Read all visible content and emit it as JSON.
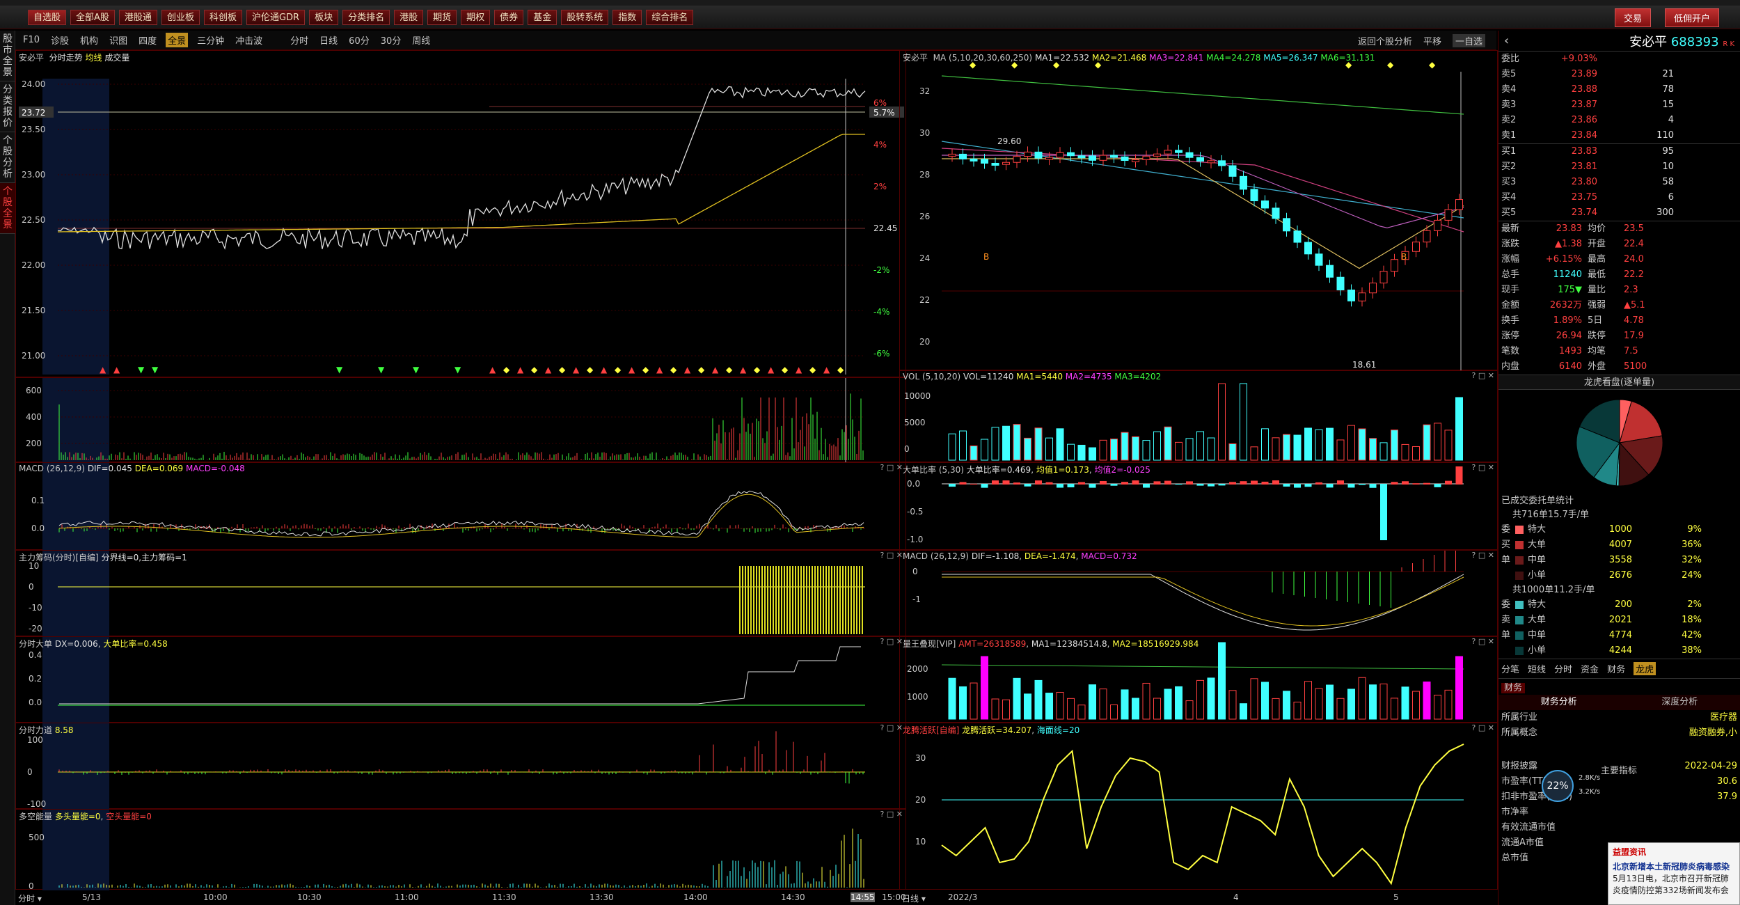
{
  "toolbar": {
    "buttons": [
      "自选股",
      "全部A股",
      "港股通",
      "创业板",
      "科创板",
      "沪伦通GDR",
      "板块",
      "分类排名",
      "港股",
      "期货",
      "期权",
      "债券",
      "基金",
      "股转系统",
      "指数",
      "综合排名"
    ],
    "right": [
      "交易",
      "低佣开户"
    ]
  },
  "left_tabs": [
    "股市全景",
    "分类报价",
    "个股分析",
    "个股全景"
  ],
  "subbar": {
    "items": [
      "F10",
      "诊股",
      "机构",
      "识图",
      "四度",
      "全景",
      "三分钟",
      "冲击波",
      "分时",
      "日线",
      "60分",
      "30分",
      "周线"
    ],
    "active": "全景",
    "right": [
      "返回个股分析",
      "平移",
      "一自选"
    ]
  },
  "intraday": {
    "stock": "安必平",
    "title": "分时走势",
    "legend_avg": "均线",
    "legend_vol": "成交量",
    "y_ticks": [
      "24.00",
      "23.50",
      "23.00",
      "22.50",
      "22.00",
      "21.50",
      "21.00"
    ],
    "pct_ticks": [
      "6%",
      "4%",
      "2%",
      "-2%",
      "-4%",
      "-6%"
    ],
    "ref_price": "22.45",
    "cur_price": "23.72",
    "cur_pct": "5.7%",
    "vol_ticks": [
      "600",
      "400",
      "200"
    ],
    "macd_label": "MACD",
    "macd_params": "(26,12,9)",
    "macd_dif": "DIF=0.045",
    "macd_dea": "DEA=0.069",
    "macd_val": "MACD=-0.048",
    "chip_label": "主力筹码(分时)[自编]",
    "chip_value": "分界线=0,主力筹码=1",
    "chip_ticks": [
      "10",
      "0",
      "-10",
      "-20"
    ],
    "bigorder_label": "分时大单",
    "bigorder_dx": "DX=0.006",
    "bigorder_ratio": "大单比率=0.458",
    "bigorder_ticks": [
      "0.4",
      "0.2",
      "0.0"
    ],
    "force_label": "分时力道",
    "force_value": "8.58",
    "force_ticks": [
      "100",
      "0",
      "-100"
    ],
    "energy_label": "多空能量",
    "energy_value": "多头量能=0",
    "energy_value2": "空头量能=0",
    "energy_ticks": [
      "500",
      "0"
    ],
    "time_ticks": [
      "5/13",
      "10:00",
      "10:30",
      "11:00",
      "11:30",
      "13:30",
      "14:00",
      "14:30",
      "14:55",
      "15:00"
    ],
    "time_label": "分时"
  },
  "daily": {
    "stock": "安必平",
    "ma_label": "MA",
    "ma_params": "(5,10,20,30,60,250)",
    "ma1": "MA1=22.532",
    "ma2": "MA2=21.468",
    "ma3": "MA3=22.841",
    "ma4": "MA4=24.278",
    "ma5": "MA5=26.347",
    "ma6": "MA6=31.131",
    "y_ticks": [
      "32",
      "30",
      "28",
      "26",
      "24",
      "22",
      "20"
    ],
    "high_mark": "29.60",
    "low_mark": "18.61",
    "vol_label": "VOL",
    "vol_params": "(5,10,20)",
    "vol_val": "VOL=11240",
    "vol_ma1": "MA1=5440",
    "vol_ma2": "MA2=4735",
    "vol_ma3": "MA3=4202",
    "vol_ticks": [
      "10000",
      "5000",
      "0"
    ],
    "bigratio_label": "大单比率",
    "bigratio_params": "(5,30)",
    "bigratio_val": "大单比率=0.469",
    "bigratio_avg1": "均值1=0.173",
    "bigratio_avg2": "均值2=-0.025",
    "bigratio_ticks": [
      "0.0",
      "-0.5",
      "-1.0"
    ],
    "macd_label": "MACD",
    "macd_params": "(26,12,9)",
    "macd_dif": "DIF=-1.108",
    "macd_dea": "DEA=-1.474",
    "macd_val": "MACD=0.732",
    "macd_ticks": [
      "0",
      "-1"
    ],
    "vip_label": "量王叠现[VIP]",
    "vip_amt": "AMT=26318589",
    "vip_ma1": "MA1=12384514.8",
    "vip_ma2": "MA2=18516929.984",
    "vip_ticks": [
      "2000",
      "1000"
    ],
    "dragon_label": "龙腾活跃[自编]",
    "dragon_val": "龙腾活跃=34.207",
    "dragon_line": "海面线=20",
    "dragon_ticks": [
      "30",
      "20",
      "10"
    ],
    "date_ticks": [
      "2022/3",
      "4",
      "5"
    ],
    "date_label": "日线"
  },
  "quote": {
    "name": "安必平",
    "code": "688393",
    "rk": "R K",
    "webi": "委比",
    "webi_val": "+9.03%",
    "sell": [
      [
        "卖5",
        "23.89",
        "21"
      ],
      [
        "卖4",
        "23.88",
        "78"
      ],
      [
        "卖3",
        "23.87",
        "15"
      ],
      [
        "卖2",
        "23.86",
        "4"
      ],
      [
        "卖1",
        "23.84",
        "110"
      ]
    ],
    "buy": [
      [
        "买1",
        "23.83",
        "95"
      ],
      [
        "买2",
        "23.81",
        "10"
      ],
      [
        "买3",
        "23.80",
        "58"
      ],
      [
        "买4",
        "23.75",
        "6"
      ],
      [
        "买5",
        "23.74",
        "300"
      ]
    ],
    "stats": [
      [
        "最新",
        "23.83",
        "均价",
        "23.5"
      ],
      [
        "涨跌",
        "▲1.38",
        "开盘",
        "22.4"
      ],
      [
        "涨幅",
        "+6.15%",
        "最高",
        "24.0"
      ],
      [
        "总手",
        "11240",
        "最低",
        "22.2"
      ],
      [
        "现手",
        "175▼",
        "量比",
        "2.3"
      ],
      [
        "金额",
        "2632万",
        "强弱",
        "▲5.1"
      ],
      [
        "换手",
        "1.89%",
        "5日",
        "4.78"
      ],
      [
        "涨停",
        "26.94",
        "跌停",
        "17.9"
      ],
      [
        "笔数",
        "1493",
        "均笔",
        "7.5"
      ],
      [
        "内盘",
        "6140",
        "外盘",
        "5100"
      ]
    ]
  },
  "dragon": {
    "title": "龙虎看盘(逐单量)",
    "pie": [
      {
        "name": "特大红",
        "value": 9,
        "color": "#ff6060"
      },
      {
        "name": "大单红",
        "value": 36,
        "color": "#c03030"
      },
      {
        "name": "中单红",
        "value": 32,
        "color": "#6a1a1a"
      },
      {
        "name": "小单红",
        "value": 24,
        "color": "#401010"
      },
      {
        "name": "特大绿",
        "value": 2,
        "color": "#40c0c0"
      },
      {
        "name": "大单绿",
        "value": 18,
        "color": "#208888"
      },
      {
        "name": "中单绿",
        "value": 42,
        "color": "#106060"
      },
      {
        "name": "小单绿",
        "value": 38,
        "color": "#083838"
      }
    ],
    "sub": "已成交委托单统计",
    "buy_total": "共716单15.7手/单",
    "buy_rows": [
      [
        "委",
        "特大",
        "1000",
        "9%"
      ],
      [
        "买",
        "大单",
        "4007",
        "36%"
      ],
      [
        "单",
        "中单",
        "3558",
        "32%"
      ],
      [
        "",
        "小单",
        "2676",
        "24%"
      ]
    ],
    "sell_total": "共1000单11.2手/单",
    "sell_rows": [
      [
        "委",
        "特大",
        "200",
        "2%"
      ],
      [
        "卖",
        "大单",
        "2021",
        "18%"
      ],
      [
        "单",
        "中单",
        "4774",
        "42%"
      ],
      [
        "",
        "小单",
        "4244",
        "38%"
      ]
    ],
    "tabs": [
      "分笔",
      "短线",
      "分时",
      "资金",
      "财务",
      "龙虎"
    ],
    "active_tab": "龙虎"
  },
  "finance": {
    "tab": "财务",
    "headers": [
      "财务分析",
      "深度分析"
    ],
    "rows": [
      [
        "所属行业",
        "医疗器"
      ],
      [
        "所属概念",
        "融资融券,小"
      ],
      [
        "财报披露",
        "2022-04-29"
      ],
      [
        "市盈率(TTM)",
        "30.6"
      ],
      [
        "扣非市盈率(TTM)",
        "37.9"
      ],
      [
        "市净率",
        ""
      ],
      [
        "有效流通市值",
        ""
      ],
      [
        "流通A市值",
        ""
      ],
      [
        "总市值",
        ""
      ]
    ],
    "key_label": "主要指标",
    "speed": "22%",
    "up": "2.8K/s",
    "down": "3.2K/s"
  },
  "news": {
    "source": "益盟资讯",
    "headline": "北京新增本土新冠肺炎病毒感染",
    "body": "5月13日电，北京市召开新冠肺炎疫情防控第332场新闻发布会"
  }
}
